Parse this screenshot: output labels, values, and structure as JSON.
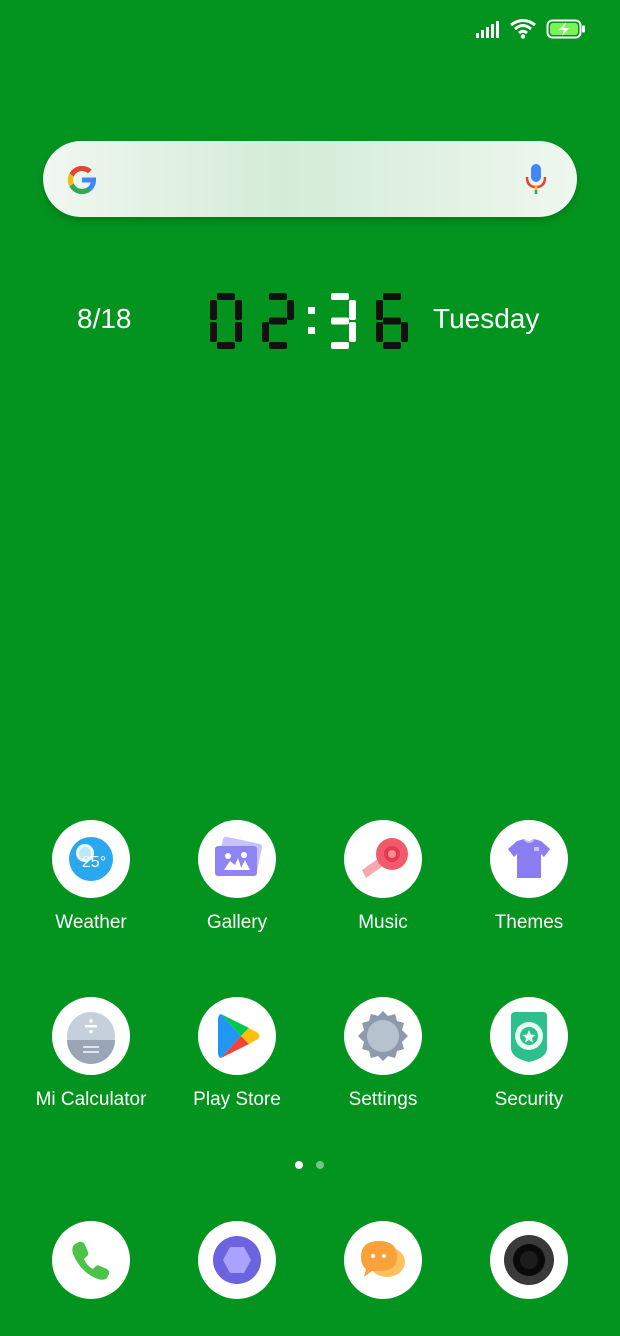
{
  "status_bar": {
    "signal": "signal-icon",
    "wifi": "wifi-icon",
    "battery": "battery-charging-icon"
  },
  "search": {
    "logo": "google-logo-icon",
    "mic": "mic-icon"
  },
  "clock": {
    "date": "8/18",
    "time": "02:36",
    "day": "Tuesday"
  },
  "weather_badge": "25°",
  "apps_row1": [
    {
      "label": "Weather",
      "icon": "weather-icon"
    },
    {
      "label": "Gallery",
      "icon": "gallery-icon"
    },
    {
      "label": "Music",
      "icon": "music-icon"
    },
    {
      "label": "Themes",
      "icon": "themes-icon"
    }
  ],
  "apps_row2": [
    {
      "label": "Mi Calculator",
      "icon": "calculator-icon"
    },
    {
      "label": "Play Store",
      "icon": "play-store-icon"
    },
    {
      "label": "Settings",
      "icon": "settings-icon"
    },
    {
      "label": "Security",
      "icon": "security-icon"
    }
  ],
  "page_indicator": {
    "total": 2,
    "current": 1
  },
  "dock": [
    {
      "icon": "phone-icon"
    },
    {
      "icon": "browser-icon"
    },
    {
      "icon": "messages-icon"
    },
    {
      "icon": "camera-icon"
    }
  ],
  "colors": {
    "wallpaper": "#03941f",
    "battery": "#7cf25a"
  }
}
